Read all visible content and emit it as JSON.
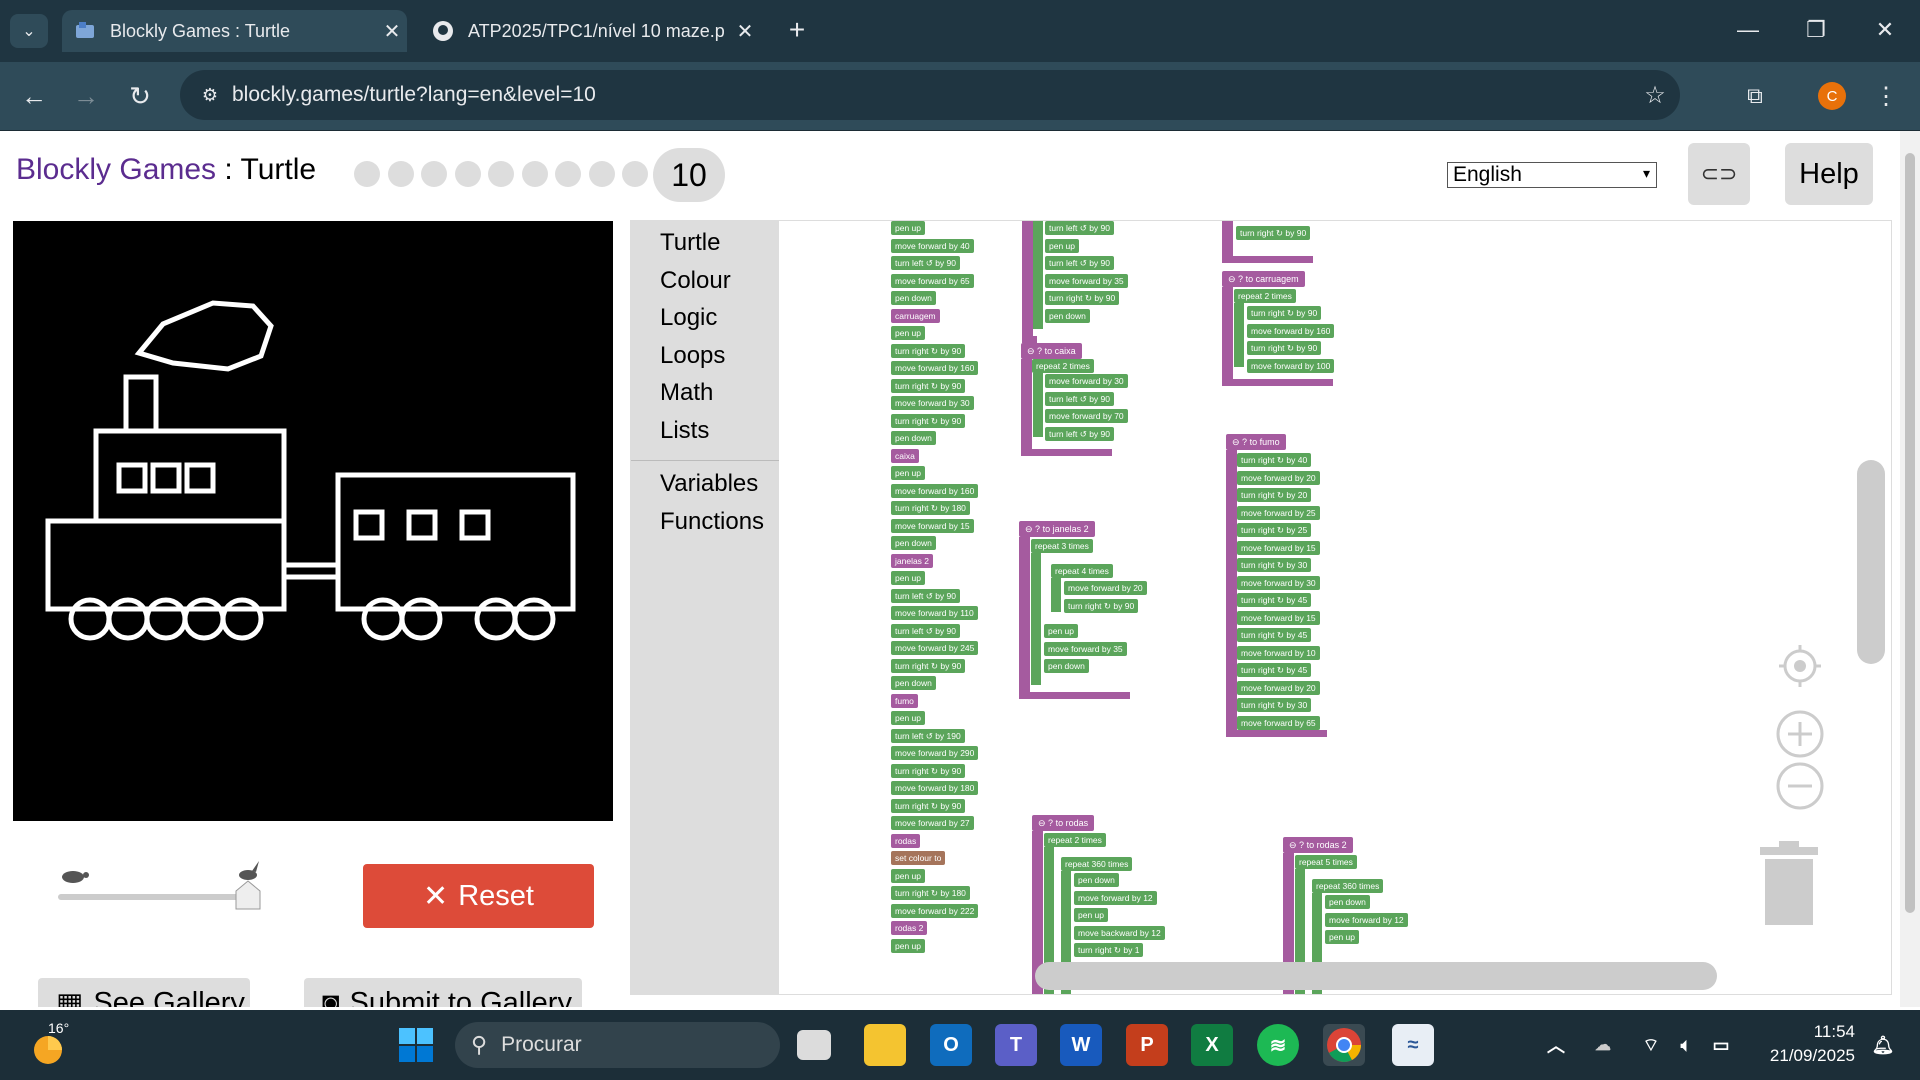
{
  "browser": {
    "tabs": [
      {
        "title": "Blockly Games : Turtle"
      },
      {
        "title": "ATP2025/TPC1/nível 10 maze.p"
      }
    ],
    "url": "blockly.games/turtle?lang=en&level=10",
    "profile_initial": "C"
  },
  "header": {
    "brand": "Blockly Games",
    "separator": " : ",
    "game": "Turtle",
    "level_current": "10",
    "language": "English",
    "help_label": "Help"
  },
  "controls": {
    "reset_label": "Reset",
    "see_gallery_label": "See Gallery",
    "submit_gallery_label": "Submit to Gallery"
  },
  "toolbox": {
    "categories": [
      "Turtle",
      "Colour",
      "Logic",
      "Loops",
      "Math",
      "Lists"
    ],
    "variables": [
      "Variables",
      "Functions"
    ]
  },
  "blocks": {
    "main_stack": [
      "pen up",
      "move forward by 40",
      "turn left ↺ by 90",
      "move forward by 65",
      "pen down",
      "carruagem",
      "pen up",
      "turn right ↻ by 90",
      "move forward by 160",
      "turn right ↻ by 90",
      "move forward by 30",
      "turn right ↻ by 90",
      "pen down",
      "caixa",
      "pen up",
      "move forward by 160",
      "turn right ↻ by 180",
      "move forward by 15",
      "pen down",
      "janelas 2",
      "pen up",
      "turn left ↺ by 90",
      "move forward by 110",
      "turn left ↺ by 90",
      "move forward by 245",
      "turn right ↻ by 90",
      "pen down",
      "fumo",
      "pen up",
      "turn left ↺ by 190",
      "move forward by 290",
      "turn right ↻ by 90",
      "move forward by 180",
      "turn right ↻ by 90",
      "move forward by 27",
      "rodas",
      "set colour to",
      "pen up",
      "turn right ↻ by 180",
      "move forward by 222",
      "rodas 2",
      "pen up"
    ],
    "func_top_left": [
      "turn left ↺ by 90",
      "pen up",
      "turn left ↺ by 90",
      "move forward by 35",
      "turn right ↻ by 90",
      "pen down"
    ],
    "func_top_right": [
      "turn right ↻ by 90"
    ],
    "func_caixa": {
      "name": "to caixa",
      "repeat": "2",
      "times": "times",
      "do": "do",
      "body": [
        "move forward by 30",
        "turn left ↺ by 90",
        "move forward by 70",
        "turn left ↺ by 90"
      ]
    },
    "func_carruagem": {
      "name": "to carruagem",
      "repeat": "2",
      "body": [
        "turn right ↻ by 90",
        "move forward by 160",
        "turn right ↻ by 90",
        "move forward by 100"
      ]
    },
    "func_janelas": {
      "name": "to janelas 2",
      "repeat_outer": "3",
      "repeat_inner": "4",
      "body_inner": [
        "move forward by 20",
        "turn right ↻ by 90"
      ],
      "body_after": [
        "pen up",
        "move forward by 35",
        "pen down"
      ]
    },
    "func_fumo": {
      "name": "to fumo",
      "body": [
        "turn right ↻ by 40",
        "move forward by 20",
        "turn right ↻ by 20",
        "move forward by 25",
        "turn right ↻ by 25",
        "move forward by 15",
        "turn right ↻ by 30",
        "move forward by 30",
        "turn right ↻ by 45",
        "move forward by 15",
        "turn right ↻ by 45",
        "move forward by 10",
        "turn right ↻ by 45",
        "move forward by 20",
        "turn right ↻ by 30",
        "move forward by 65"
      ]
    },
    "func_rodas": {
      "name": "to rodas",
      "repeat_outer": "2",
      "repeat_inner": "360",
      "body": [
        "pen down",
        "move forward by 12",
        "pen up",
        "move backward by 12",
        "turn right ↻ by 1"
      ]
    },
    "func_rodas2": {
      "name": "to rodas 2",
      "repeat_outer": "5",
      "repeat_inner": "360",
      "body": [
        "pen down",
        "move forward by 12",
        "pen up"
      ]
    },
    "labels": {
      "repeat": "repeat",
      "times": "times",
      "do": "do"
    }
  },
  "taskbar": {
    "temperature": "16°",
    "search_placeholder": "Procurar",
    "time": "11:54",
    "date": "21/09/2025"
  },
  "colors": {
    "brand": "#5b2c8f",
    "reset": "#dd4b39",
    "block_green": "#5ba55b",
    "block_purple": "#a55b9f",
    "block_brown": "#a5745b"
  }
}
